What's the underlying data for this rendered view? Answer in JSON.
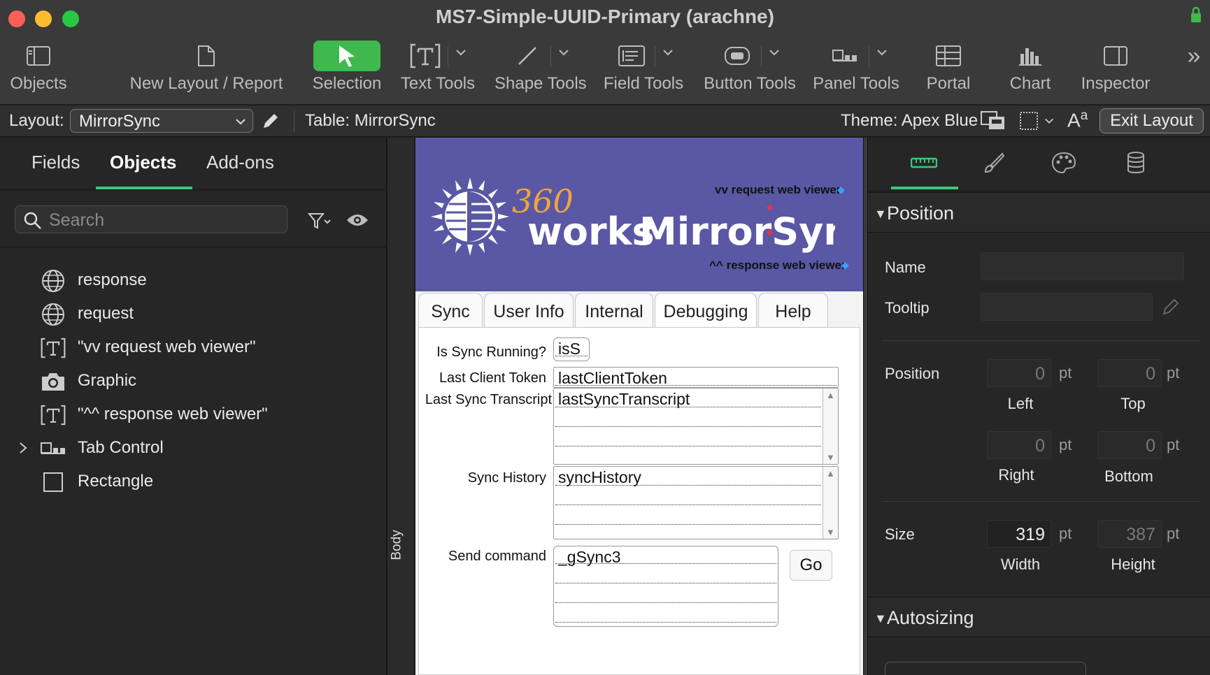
{
  "window": {
    "title": "MS7-Simple-UUID-Primary (arachne)",
    "traffic_colors": [
      "#ff5f57",
      "#febc2e",
      "#28c840"
    ]
  },
  "toolbar": {
    "items": [
      {
        "label": "Objects",
        "icon": "sidebar-icon"
      },
      {
        "label": "New Layout / Report",
        "icon": "document-icon"
      },
      {
        "label": "Selection",
        "icon": "pointer-icon"
      },
      {
        "label": "Text Tools",
        "icon": "text-tool-icon"
      },
      {
        "label": "Shape Tools",
        "icon": "line-icon"
      },
      {
        "label": "Field Tools",
        "icon": "field-icon"
      },
      {
        "label": "Button Tools",
        "icon": "button-icon"
      },
      {
        "label": "Panel Tools",
        "icon": "panel-icon"
      },
      {
        "label": "Portal",
        "icon": "portal-icon"
      },
      {
        "label": "Chart",
        "icon": "chart-icon"
      },
      {
        "label": "Inspector",
        "icon": "inspector-icon"
      }
    ],
    "overflow": "»"
  },
  "layoutbar": {
    "layout_label": "Layout:",
    "layout_value": "MirrorSync",
    "table_label": "Table: MirrorSync",
    "theme_label": "Theme: Apex Blue",
    "exit_button": "Exit Layout"
  },
  "leftpane": {
    "tabs": [
      "Fields",
      "Objects",
      "Add-ons"
    ],
    "active_tab": "Objects",
    "search_placeholder": "Search",
    "objects": [
      {
        "label": "response",
        "icon": "globe-icon"
      },
      {
        "label": "request",
        "icon": "globe-icon"
      },
      {
        "label": "\"vv request web viewer\"",
        "icon": "text-object-icon"
      },
      {
        "label": "Graphic",
        "icon": "camera-icon"
      },
      {
        "label": "\"^^ response web viewer\"",
        "icon": "text-object-icon"
      },
      {
        "label": "Tab Control",
        "icon": "tab-control-icon"
      },
      {
        "label": "Rectangle",
        "icon": "rectangle-icon"
      }
    ]
  },
  "canvas": {
    "part_label": "Body",
    "header_color": "#5a57a4",
    "logo": {
      "num": "360",
      "works": "works",
      "product": "MirrorSync"
    },
    "request_viewer_label": "vv request web viewer",
    "response_viewer_label": "^^ response web viewer",
    "tabs": [
      "Sync",
      "User Info",
      "Internal",
      "Debugging",
      "Help"
    ],
    "fields": {
      "is_sync_running_label": "Is Sync Running?",
      "is_sync_running_value": "isS",
      "last_client_token_label": "Last Client Token",
      "last_client_token_value": "lastClientToken",
      "last_sync_transcript_label": "Last Sync Transcript",
      "last_sync_transcript_value": "lastSyncTranscript",
      "sync_history_label": "Sync History",
      "sync_history_value": "syncHistory",
      "send_command_label": "Send command",
      "send_command_value": "_gSync3",
      "go_button": "Go"
    }
  },
  "inspector": {
    "tabs": [
      "position-icon",
      "brush-icon",
      "palette-icon",
      "database-icon"
    ],
    "accent": "#39c87a",
    "position_section": "Position",
    "name_label": "Name",
    "tooltip_label": "Tooltip",
    "position_label": "Position",
    "left": "0",
    "top": "0",
    "right": "0",
    "bottom": "0",
    "left_label": "Left",
    "top_label": "Top",
    "right_label": "Right",
    "bottom_label": "Bottom",
    "size_label": "Size",
    "width": "319",
    "height": "387",
    "width_label": "Width",
    "height_label": "Height",
    "unit": "pt",
    "autosizing_section": "Autosizing"
  }
}
